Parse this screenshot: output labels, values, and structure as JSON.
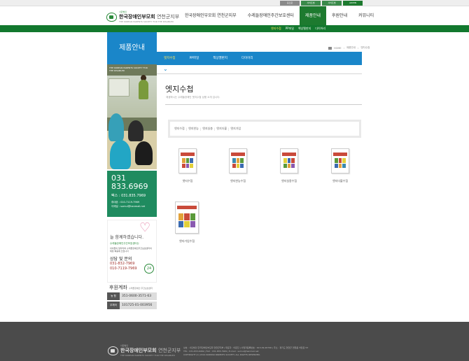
{
  "top_links": [
    {
      "label": "홈으로",
      "style": "gray"
    },
    {
      "label": "사이트맵",
      "style": "normal"
    },
    {
      "label": "사이트맵",
      "style": "normal"
    },
    {
      "label": "ADMIN",
      "style": "green"
    }
  ],
  "logo": {
    "small": "사단법인",
    "main": "한국장애인부모회",
    "branch": "연천군지부",
    "sub": "THE KOREAN PARENTS SOCIETY FOR THE DISABLED"
  },
  "gnb": [
    {
      "label": "한국장애인부모회 연천군지부",
      "active": false
    },
    {
      "label": "수레들장애인주간보호센터",
      "active": false
    },
    {
      "label": "제품안내",
      "active": true
    },
    {
      "label": "후원안내",
      "active": false
    },
    {
      "label": "커뮤니티",
      "active": false
    }
  ],
  "subnav": [
    {
      "label": "엣지수첩",
      "active": true
    },
    {
      "label": "PP파일",
      "active": false
    },
    {
      "label": "책상멜판지",
      "active": false
    },
    {
      "label": "다이어리",
      "active": false
    }
  ],
  "sidebar": {
    "title": "제품안내",
    "banner_caption": "THE KOREAN PARENTS SOCIETY FOR THE DISABLED",
    "contact": {
      "phone_area": "031",
      "phone_number": "833.6969",
      "fax": "팩스 : 031.835.7969",
      "mobile": "휴대폰 : 010-7119-7969",
      "email": "이메일 : sumul@hanmail.net"
    },
    "promo": {
      "script": "늘 함께하겠습니다.",
      "line1": "수레들장애인주간보호센터는",
      "line2": "아이들의 일자리와 수레들장애인주간보호센터의 재정 확충에 쓰입니다",
      "inquiry_title": "상담 및 문의",
      "phone1": "031-832-7969",
      "phone2": "010-7119-7969",
      "badge": "24"
    },
    "account": {
      "title": "후원계좌",
      "holder": "수레들장애인 주간보호센터",
      "rows": [
        {
          "bank": "농 협",
          "number": "351-0600-3571-63"
        },
        {
          "bank": "우체국",
          "number": "101725-01-003956"
        }
      ]
    }
  },
  "breadcrumb": [
    "HOME",
    "제품안내",
    "엣지수첩"
  ],
  "tabs": [
    {
      "label": "엣지수첩",
      "active": true
    },
    {
      "label": "PP파일",
      "active": false
    },
    {
      "label": "책상멜판지",
      "active": false
    },
    {
      "label": "다이어리",
      "active": false
    }
  ],
  "main": {
    "title": "엣지수첩",
    "description": "재생하시는 수레들장애인 엣지수첩 상품 소개 입니다.",
    "filters": [
      "엣지수첩",
      "엣지한능",
      "엣지실총",
      "엣지더블",
      "엣지가업"
    ],
    "products": [
      {
        "label": "엣지수첩"
      },
      {
        "label": "엣지한능수첩"
      },
      {
        "label": "엣지실용수첩"
      },
      {
        "label": "엣지더블수첩"
      },
      {
        "label": "엣지가업수첩"
      }
    ]
  },
  "footer": {
    "logo_small": "사단법인",
    "logo_main": "한국장애인부모회",
    "logo_branch": "연천군지부",
    "logo_sub": "THE KOREAN PARENTS SOCIETY FOR THE DISABLED",
    "info_line1": "상호 : 사단법인 한국장애인부모회 연천군지부 | 대표자 : 이문진 | 사업자등록번호 : 613-09-26796 | 주소 : 경기도 연천군 연천읍 차탄로 53",
    "info_line2": "TEL : 031-833-6969 | FAX : 031-835-7969 | E-mail : sumul@hanmail.net",
    "info_line3": "COPYRIGHT (C) 2014 KOREAN PARENTS SOCIETY. ALL RIGHTS RESERVED."
  }
}
